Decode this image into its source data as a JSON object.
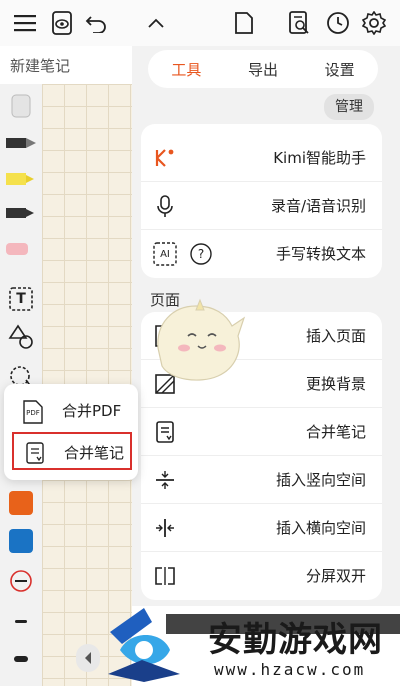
{
  "topbar": {
    "icons": [
      "menu-icon",
      "eye-icon",
      "undo-icon",
      "chevron-up-icon",
      "page-icon",
      "search-doc-icon",
      "clock-icon",
      "gear-icon"
    ]
  },
  "note": {
    "title": "新建笔记"
  },
  "tabs": {
    "tools": "工具",
    "export": "导出",
    "settings": "设置",
    "active": "工具"
  },
  "manage_label": "管理",
  "top_card": {
    "rows": [
      {
        "label": "Kimi智能助手"
      },
      {
        "label": "录音/语音识别"
      },
      {
        "label": "手写转换文本",
        "icon_text": "AI"
      }
    ]
  },
  "page_section": {
    "title": "页面",
    "rows": [
      {
        "label": "插入页面"
      },
      {
        "label": "更换背景"
      },
      {
        "label": "合并笔记"
      },
      {
        "label": "插入竖向空间"
      },
      {
        "label": "插入横向空间"
      },
      {
        "label": "分屏双开"
      }
    ]
  },
  "popup": {
    "items": [
      {
        "label": "合并PDF",
        "icon_text": "PDF"
      },
      {
        "label": "合并笔记"
      }
    ]
  },
  "left_toolbar": {
    "text_tool_label": "T",
    "colors": [
      "#e8621a",
      "#1a73c4"
    ]
  },
  "watermark": {
    "text": "安勤游戏网",
    "url": "www.hzacw.com"
  },
  "colors": {
    "accent": "#e8561f",
    "selection_border": "#d9302c"
  }
}
